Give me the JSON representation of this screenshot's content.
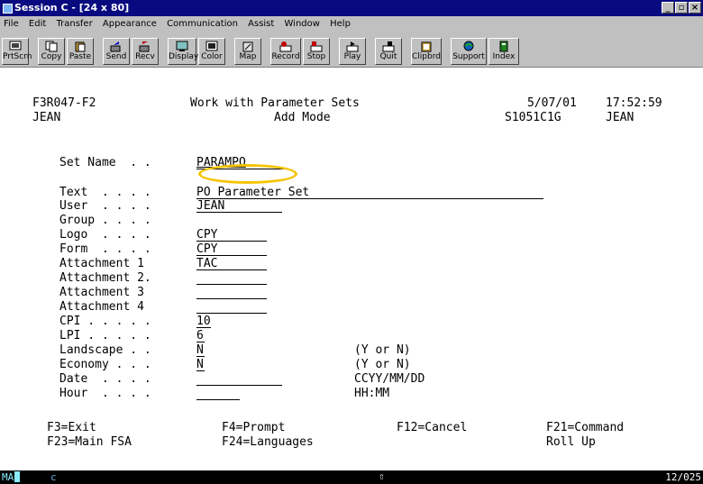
{
  "window": {
    "title": "Session C - [24 x 80]",
    "buttons": [
      "_",
      "▫",
      "×"
    ]
  },
  "menu": [
    "File",
    "Edit",
    "Transfer",
    "Appearance",
    "Communication",
    "Assist",
    "Window",
    "Help"
  ],
  "toolbar": [
    {
      "label": "PrtScrn",
      "icon": "print-screen-icon"
    },
    {
      "label": "Copy",
      "icon": "copy-icon"
    },
    {
      "label": "Paste",
      "icon": "paste-icon"
    },
    {
      "label": "Send",
      "icon": "send-icon"
    },
    {
      "label": "Recv",
      "icon": "receive-icon"
    },
    {
      "label": "Display",
      "icon": "display-icon"
    },
    {
      "label": "Color",
      "icon": "color-icon"
    },
    {
      "label": "Map",
      "icon": "map-icon"
    },
    {
      "label": "Record",
      "icon": "record-icon"
    },
    {
      "label": "Stop",
      "icon": "stop-icon"
    },
    {
      "label": "Play",
      "icon": "play-icon"
    },
    {
      "label": "Quit",
      "icon": "quit-icon"
    },
    {
      "label": "Clipbrd",
      "icon": "clipboard-icon"
    },
    {
      "label": "Support",
      "icon": "support-icon"
    },
    {
      "label": "Index",
      "icon": "index-icon"
    }
  ],
  "screen": {
    "program": "F3R047-F2",
    "title": "Work with Parameter Sets",
    "date": "5/07/01",
    "time": "17:52:59",
    "user": "JEAN",
    "mode": "Add Mode",
    "system": "S1051C1G",
    "user2": "JEAN",
    "fields": [
      {
        "label": "Set Name  . .",
        "value": "PARAMPO"
      },
      {
        "label": "Text  . . . .",
        "value": "PO Parameter Set"
      },
      {
        "label": "User  . . . .",
        "value": "JEAN"
      },
      {
        "label": "Group . . . .",
        "value": ""
      },
      {
        "label": "Logo  . . . .",
        "value": "CPY"
      },
      {
        "label": "Form  . . . .",
        "value": "CPY"
      },
      {
        "label": "Attachment 1",
        "value": "TAC"
      },
      {
        "label": "Attachment 2.",
        "value": ""
      },
      {
        "label": "Attachment 3",
        "value": ""
      },
      {
        "label": "Attachment 4",
        "value": ""
      },
      {
        "label": "CPI . . . . .",
        "value": "10"
      },
      {
        "label": "LPI . . . . .",
        "value": "6"
      },
      {
        "label": "Landscape . .",
        "value": "N",
        "hint": "(Y or N)"
      },
      {
        "label": "Economy . . .",
        "value": "N",
        "hint": "(Y or N)"
      },
      {
        "label": "Date  . . . .",
        "value": "",
        "hint": "CCYY/MM/DD"
      },
      {
        "label": "Hour  . . . .",
        "value": "",
        "hint": "HH:MM"
      }
    ],
    "fkeys": {
      "f3": "F3=Exit",
      "f4": "F4=Prompt",
      "f12": "F12=Cancel",
      "f21": "F21=Command",
      "f23": "F23=Main FSA",
      "f24": "F24=Languages",
      "roll": "Roll Up"
    }
  },
  "status": {
    "left": "MA",
    "session": "c",
    "right": "12/025",
    "arrow": "⇧"
  },
  "colors": {
    "title_bg": "#0a0a80",
    "face": "#c0c0c0",
    "highlight": "#f5c400"
  }
}
